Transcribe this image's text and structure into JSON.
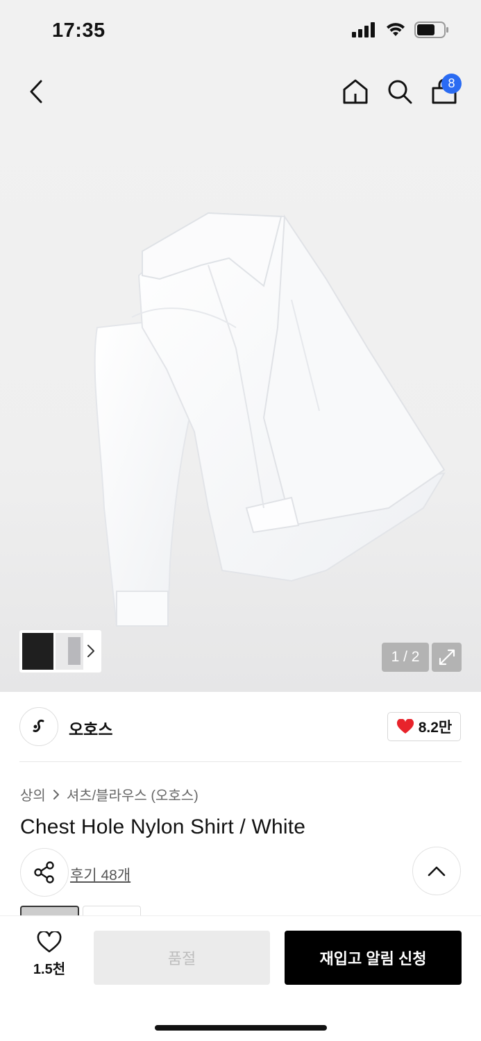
{
  "status_bar": {
    "time": "17:35"
  },
  "header": {
    "cart_count": "8"
  },
  "gallery": {
    "page_indicator": "1 / 2"
  },
  "brand": {
    "name": "오호스",
    "likes": "8.2만"
  },
  "product": {
    "breadcrumb": [
      "상의",
      "셔츠/블라우스 (오호스)"
    ],
    "title": "Chest Hole Nylon Shirt / White",
    "review_link": "후기 48개"
  },
  "bottom_bar": {
    "wish_count": "1.5천",
    "soldout_label": "품절",
    "restock_label": "재입고 알림 신청"
  },
  "colors": {
    "accent_badge": "#2a6bf2",
    "heart": "#e8232b",
    "primary_button": "#000000"
  }
}
